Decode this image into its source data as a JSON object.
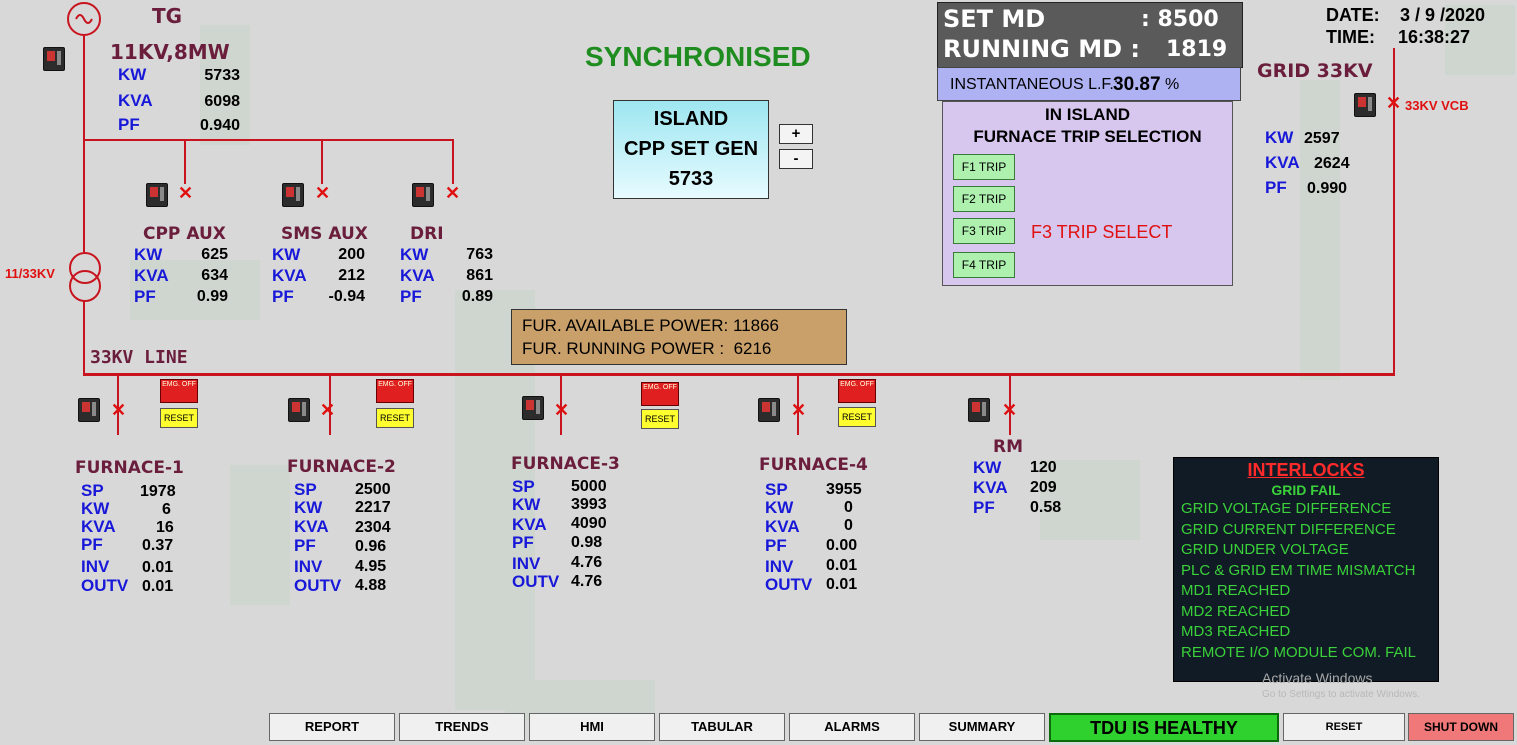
{
  "tg": {
    "name": "TG",
    "rating": "11KV,8MW",
    "kw_label": "KW",
    "kw": "5733",
    "kva_label": "KVA",
    "kva": "6098",
    "pf_label": "PF",
    "pf": "0.940"
  },
  "status_text": "SYNCHRONISED",
  "island": {
    "line1": "ISLAND",
    "line2": "CPP SET GEN",
    "value": "5733",
    "plus_label": "+",
    "minus_label": "-"
  },
  "md": {
    "set_label": "SET MD",
    "set_value": ": 8500",
    "running_label": "RUNNING MD :",
    "running_value": "1819"
  },
  "lf": {
    "label": "INSTANTANEOUS L.F.:",
    "value": "30.87",
    "unit": "%"
  },
  "datetime": {
    "date_label": "DATE:",
    "date": "3 / 9 /2020",
    "time_label": "TIME:",
    "time": "16:38:27"
  },
  "grid": {
    "name": "GRID 33KV",
    "vcb_label": "33KV VCB",
    "kw_label": "KW",
    "kw": "2597",
    "kva_label": "KVA",
    "kva": "2624",
    "pf_label": "PF",
    "pf": "0.990"
  },
  "trip_panel": {
    "title1": "IN ISLAND",
    "title2": "FURNACE TRIP SELECTION",
    "buttons": [
      "F1 TRIP",
      "F2 TRIP",
      "F3 TRIP",
      "F4 TRIP"
    ],
    "selected_text": "F3 TRIP SELECT"
  },
  "transformer_label": "11/33KV",
  "feeders": [
    {
      "name": "CPP AUX",
      "kw": "625",
      "kva": "634",
      "pf": "0.99"
    },
    {
      "name": "SMS AUX",
      "kw": "200",
      "kva": "212",
      "pf": "-0.94"
    },
    {
      "name": "DRI",
      "kw": "763",
      "kva": "861",
      "pf": "0.89"
    }
  ],
  "labels": {
    "kw": "KW",
    "kva": "KVA",
    "pf": "PF",
    "sp": "SP",
    "inv": "INV",
    "outv": "OUTV"
  },
  "fur_power": {
    "available_label": "FUR. AVAILABLE POWER:",
    "available": "11866",
    "running_label": "FUR. RUNNING POWER :",
    "running": "6216"
  },
  "line_label": "33KV LINE",
  "emg_label": "EMG. OFF",
  "reset_label": "RESET",
  "furnaces": [
    {
      "name": "FURNACE-1",
      "sp": "1978",
      "kw": "6",
      "kva": "16",
      "pf": "0.37",
      "inv": "0.01",
      "outv": "0.01"
    },
    {
      "name": "FURNACE-2",
      "sp": "2500",
      "kw": "2217",
      "kva": "2304",
      "pf": "0.96",
      "inv": "4.95",
      "outv": "4.88"
    },
    {
      "name": "FURNACE-3",
      "sp": "5000",
      "kw": "3993",
      "kva": "4090",
      "pf": "0.98",
      "inv": "4.76",
      "outv": "4.76"
    },
    {
      "name": "FURNACE-4",
      "sp": "3955",
      "kw": "0",
      "kva": "0",
      "pf": "0.00",
      "inv": "0.01",
      "outv": "0.01"
    }
  ],
  "rm": {
    "name": "RM",
    "kw": "120",
    "kva": "209",
    "pf": "0.58"
  },
  "interlocks": {
    "title": "INTERLOCKS",
    "items": [
      "GRID FAIL",
      "GRID VOLTAGE DIFFERENCE",
      "GRID CURRENT DIFFERENCE",
      "GRID UNDER VOLTAGE",
      "PLC & GRID EM TIME MISMATCH",
      "MD1 REACHED",
      "MD2 REACHED",
      "MD3 REACHED",
      "REMOTE I/O MODULE COM. FAIL"
    ]
  },
  "watermark": {
    "line1": "Activate Windows",
    "line2": "Go to Settings to activate Windows."
  },
  "nav": {
    "report": "REPORT",
    "trends": "TRENDS",
    "hmi": "HMI",
    "tabular": "TABULAR",
    "alarms": "ALARMS",
    "summary": "SUMMARY",
    "tdu_status": "TDU IS HEALTHY",
    "reset": "RESET",
    "shutdown": "SHUT DOWN"
  },
  "colors": {
    "busbar": "#c8141e",
    "maroon": "#6a1e3c",
    "value_blue": "#1818d8",
    "sync_green": "#1e8c1e",
    "interlock_red": "#ff2a2a",
    "interlock_green": "#3ad13a"
  }
}
